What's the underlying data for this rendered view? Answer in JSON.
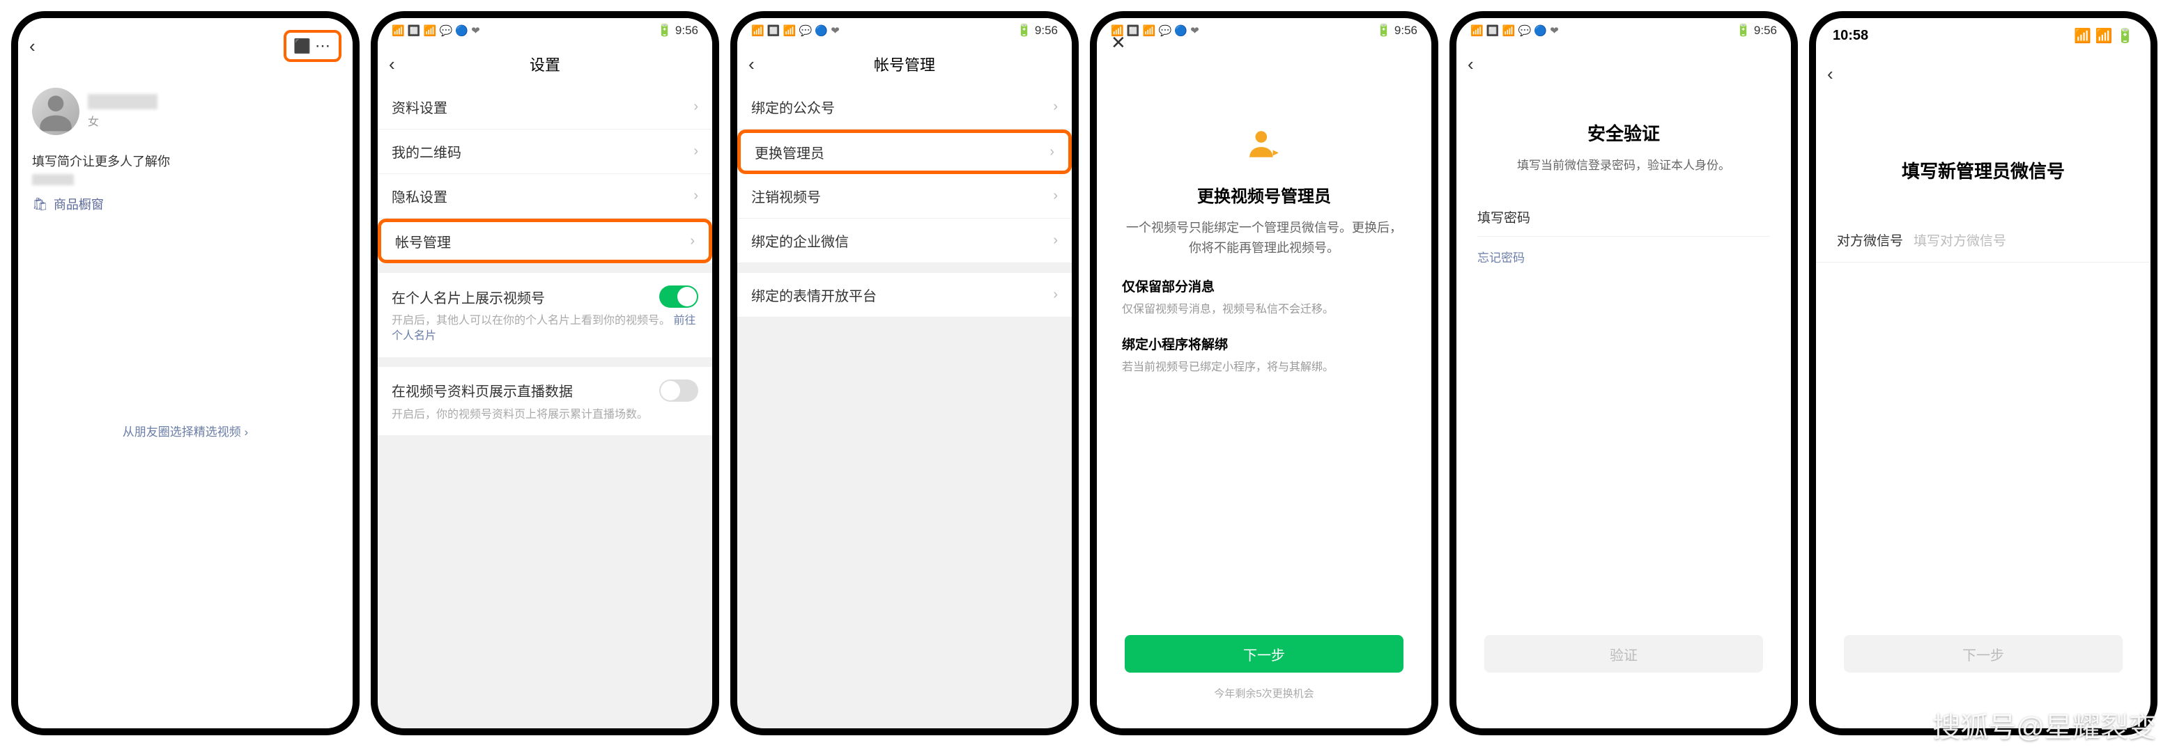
{
  "watermark": "搜狐号@星耀裂变",
  "status": {
    "icons_left": "📶 🔲 📶 💬 🔵 ❤",
    "icons_right": "🔋 9:56"
  },
  "phone1": {
    "gender": "女",
    "bio": "填写简介让更多人了解你",
    "shop_link": "商品橱窗",
    "select_video": "从朋友圈选择精选视频 ›"
  },
  "phone2": {
    "title": "设置",
    "items": [
      "资料设置",
      "我的二维码",
      "隐私设置",
      "帐号管理"
    ],
    "toggle1": {
      "label": "在个人名片上展示视频号",
      "desc": "开启后，其他人可以在你的个人名片上看到你的视频号。",
      "link": "前往个人名片"
    },
    "toggle2": {
      "label": "在视频号资料页展示直播数据",
      "desc": "开启后，你的视频号资料页上将展示累计直播场数。"
    }
  },
  "phone3": {
    "title": "帐号管理",
    "items": [
      "绑定的公众号",
      "更换管理员",
      "注销视频号",
      "绑定的企业微信",
      "绑定的表情开放平台"
    ]
  },
  "phone4": {
    "title": "更换视频号管理员",
    "desc": "一个视频号只能绑定一个管理员微信号。更换后，你将不能再管理此视频号。",
    "info1_title": "仅保留部分消息",
    "info1_desc": "仅保留视频号消息，视频号私信不会迁移。",
    "info2_title": "绑定小程序将解绑",
    "info2_desc": "若当前视频号已绑定小程序，将与其解绑。",
    "next_btn": "下一步",
    "footer": "今年剩余5次更换机会"
  },
  "phone5": {
    "title": "安全验证",
    "desc": "填写当前微信登录密码，验证本人身份。",
    "password_label": "填写密码",
    "forgot": "忘记密码",
    "verify_btn": "验证"
  },
  "phone6": {
    "time": "10:58",
    "status_icons": "📶 📶 🔋",
    "title": "填写新管理员微信号",
    "field_label": "对方微信号",
    "field_placeholder": "填写对方微信号",
    "next_btn": "下一步"
  }
}
